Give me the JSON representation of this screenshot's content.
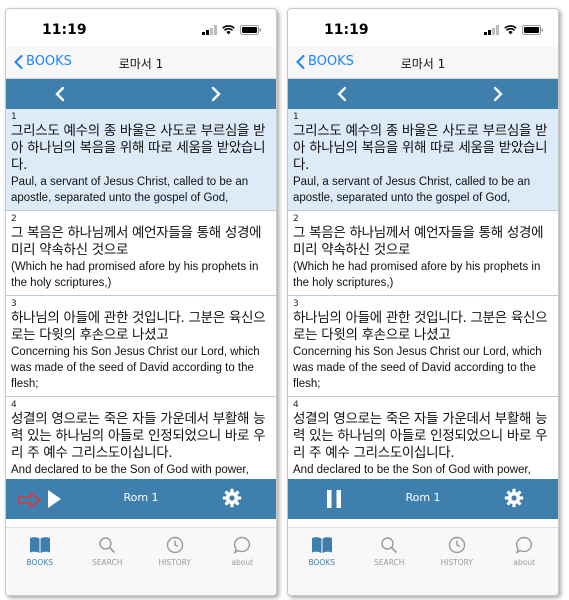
{
  "screens": [
    {
      "status": {
        "time": "11:19"
      },
      "nav": {
        "back_label": "BOOKS",
        "title": "로마서 1"
      },
      "verses": [
        {
          "num": "1",
          "ko": "그리스도 예수의 종 바울은 사도로 부르심을 받아 하나님의 복음을 위해 따로 세움을 받았습니다.",
          "en": "Paul, a servant of Jesus Christ, called to be an apostle, separated unto the gospel of God,"
        },
        {
          "num": "2",
          "ko": "그 복음은 하나님께서 예언자들을 통해 성경에 미리 약속하신 것으로",
          "en": "(Which he had promised afore by his prophets in the holy scriptures,)"
        },
        {
          "num": "3",
          "ko": "하나님의 아들에 관한 것입니다. 그분은 육신으로는 다윗의 후손으로 나셨고",
          "en": "Concerning his Son Jesus Christ our Lord, which was made of the seed of David according to the flesh;"
        },
        {
          "num": "4",
          "ko": "성결의 영으로는 죽은 자들 가운데서 부활해 능력 있는 하나님의 아들로 인정되었으니 바로 우리 주 예수 그리스도이십니다.",
          "en": "And declared to be the Son of God with power, according to the spirit of holiness, by the resurrection from the dead:"
        }
      ],
      "player": {
        "title": "Rom 1",
        "state": "play"
      },
      "tabs": [
        {
          "label": "BOOKS"
        },
        {
          "label": "SEARCH"
        },
        {
          "label": "HISTORY"
        },
        {
          "label": "about"
        }
      ]
    },
    {
      "status": {
        "time": "11:19"
      },
      "nav": {
        "back_label": "BOOKS",
        "title": "로마서 1"
      },
      "verses": [
        {
          "num": "1",
          "ko": "그리스도 예수의 종 바울은 사도로 부르심을 받아 하나님의 복음을 위해 따로 세움을 받았습니다.",
          "en": "Paul, a servant of Jesus Christ, called to be an apostle, separated unto the gospel of God,"
        },
        {
          "num": "2",
          "ko": "그 복음은 하나님께서 예언자들을 통해 성경에 미리 약속하신 것으로",
          "en": "(Which he had promised afore by his prophets in the holy scriptures,)"
        },
        {
          "num": "3",
          "ko": "하나님의 아들에 관한 것입니다. 그분은 육신으로는 다윗의 후손으로 나셨고",
          "en": "Concerning his Son Jesus Christ our Lord, which was made of the seed of David according to the flesh;"
        },
        {
          "num": "4",
          "ko": "성결의 영으로는 죽은 자들 가운데서 부활해 능력 있는 하나님의 아들로 인정되었으니 바로 우리 주 예수 그리스도이십니다.",
          "en": "And declared to be the Son of God with power, according to the spirit of holiness, by the resurrection from the dead:"
        }
      ],
      "player": {
        "title": "Rom 1",
        "state": "pause"
      },
      "tabs": [
        {
          "label": "BOOKS"
        },
        {
          "label": "SEARCH"
        },
        {
          "label": "HISTORY"
        },
        {
          "label": "about"
        }
      ]
    }
  ],
  "colors": {
    "accent": "#3f7fad",
    "link": "#1e84ff",
    "highlight": "#dcebf7",
    "annotation_arrow": "#d63a3a"
  },
  "icons": [
    "chevron-left-icon",
    "chevron-right-icon",
    "play-icon",
    "pause-icon",
    "gear-icon",
    "book-icon",
    "search-icon",
    "clock-icon",
    "chat-bubble-icon"
  ]
}
